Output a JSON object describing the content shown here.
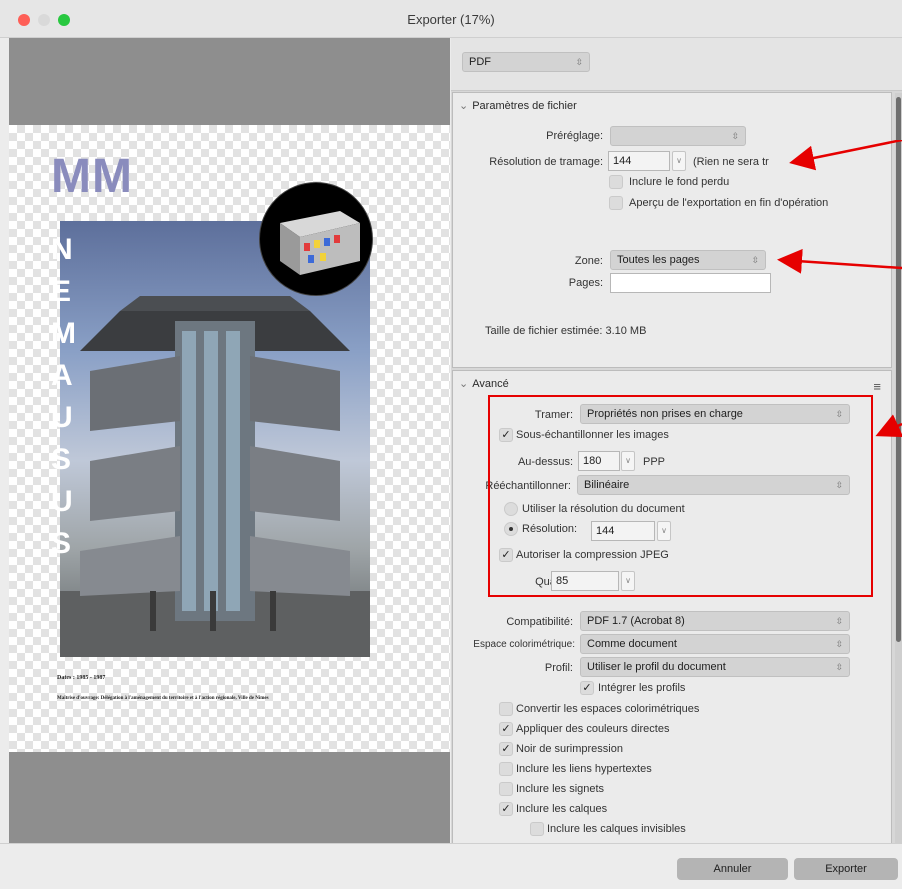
{
  "window": {
    "title": "Exporter (17%)"
  },
  "preview": {
    "logo": "MM",
    "vertical_letters": [
      "N",
      "E",
      "M",
      "A",
      "U",
      "S",
      "U",
      "S"
    ],
    "caption_dates": "Dates : 1985 - 1987",
    "caption_owner": "Maîtrise d'ouvrage: Délégation à l'aménagement du territoire et à l'action régionale, Ville de Nîmes"
  },
  "format": {
    "value": "PDF"
  },
  "file_params": {
    "header": "Paramètres de fichier",
    "preset_label": "Préréglage:",
    "preset_value": "",
    "raster_label": "Résolution de tramage:",
    "raster_value": "144",
    "raster_note": "(Rien ne sera tr",
    "bleed_label": "Inclure le fond perdu",
    "preview_label": "Aperçu de l'exportation en fin d'opération",
    "zone_label": "Zone:",
    "zone_value": "Toutes les pages",
    "pages_label": "Pages:",
    "pages_value": "",
    "size_label": "Taille de fichier estimée:",
    "size_value": "3.10 MB"
  },
  "advanced": {
    "header": "Avancé",
    "raster_label": "Tramer:",
    "raster_value": "Propriétés non prises en charge",
    "downsample_label": "Sous-échantillonner les images",
    "above_label": "Au-dessus:",
    "above_value": "180",
    "above_unit": "PPP",
    "resample_label": "Rééchantillonner:",
    "resample_value": "Bilinéaire",
    "use_doc_res_label": "Utiliser la résolution du document",
    "resolution_label": "Résolution:",
    "resolution_value": "144",
    "jpeg_label": "Autoriser la compression JPEG",
    "quality_label": "Qualité:",
    "quality_value": "85",
    "compat_label": "Compatibilité:",
    "compat_value": "PDF 1.7 (Acrobat 8)",
    "colorspace_label": "Espace colorimétrique:",
    "colorspace_value": "Comme document",
    "profile_label": "Profil:",
    "profile_value": "Utiliser le profil du document",
    "embed_profiles": "Intégrer les profils",
    "convert_spaces": "Convertir les espaces colorimétriques",
    "spot_colors": "Appliquer des couleurs directes",
    "overprint": "Noir de surimpression",
    "hyperlinks": "Inclure les liens hypertextes",
    "bookmarks": "Inclure les signets",
    "layers": "Inclure les calques",
    "hidden_layers": "Inclure les calques invisibles"
  },
  "buttons": {
    "cancel": "Annuler",
    "export": "Exporter"
  },
  "colors": {
    "annotation_red": "#e60000",
    "logo_purple": "#8a8cbd"
  }
}
